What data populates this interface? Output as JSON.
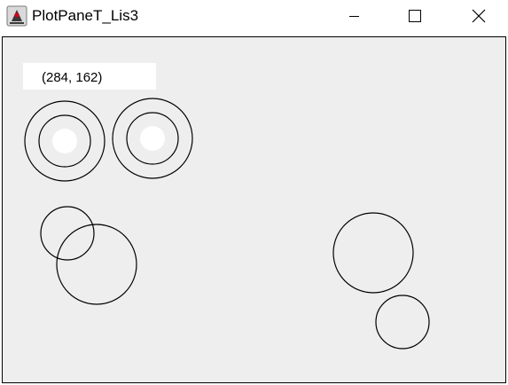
{
  "window": {
    "title": "PlotPaneT_Lis3",
    "app_icon": "java-duke-icon",
    "controls": {
      "minimize_icon": "minimize-icon",
      "maximize_icon": "maximize-icon",
      "close_icon": "close-icon"
    }
  },
  "plot": {
    "coordinate_readout": "(284, 162)",
    "background_color": "#eeeeee",
    "stroke_color": "#000000",
    "fill_color": "#ffffff"
  }
}
